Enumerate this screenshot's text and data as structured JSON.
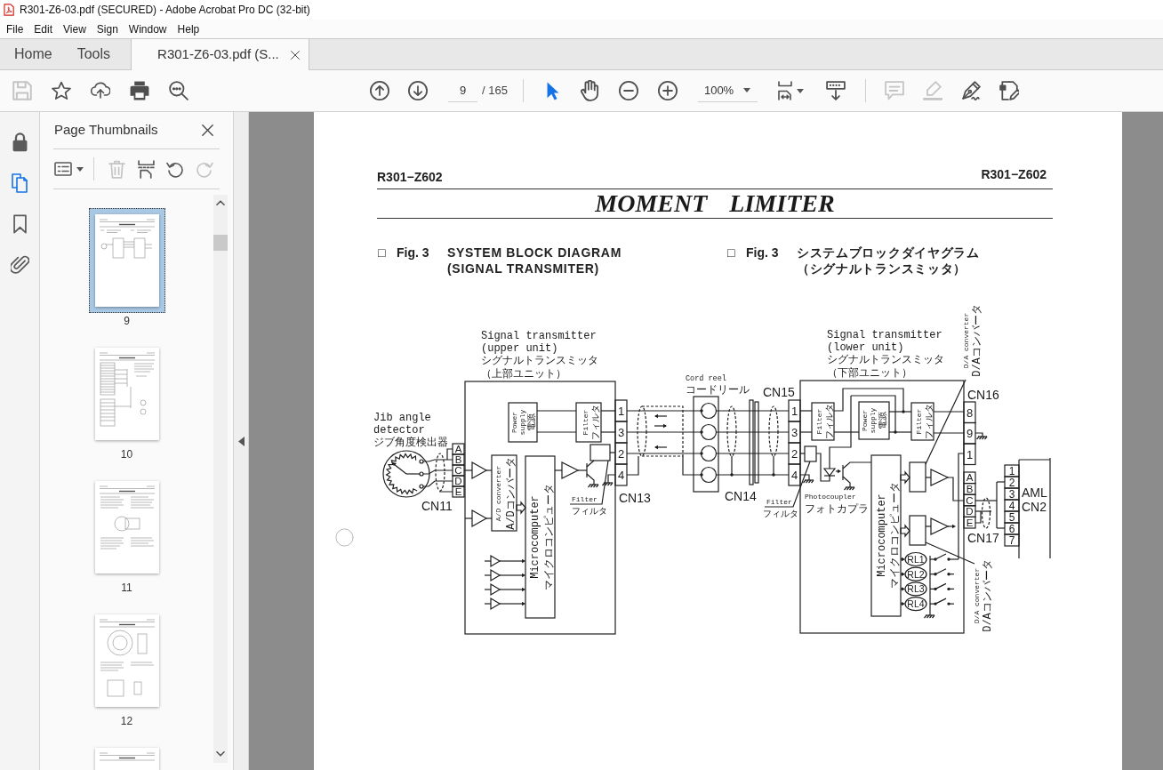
{
  "window": {
    "title": "R301-Z6-03.pdf (SECURED) - Adobe Acrobat Pro DC (32-bit)"
  },
  "menu": [
    "File",
    "Edit",
    "View",
    "Sign",
    "Window",
    "Help"
  ],
  "tabs": [
    {
      "label": "Home",
      "selected": false,
      "closable": false
    },
    {
      "label": "Tools",
      "selected": false,
      "closable": false
    },
    {
      "label": "R301-Z6-03.pdf (S...",
      "selected": true,
      "closable": true
    }
  ],
  "toolbar": {
    "file_tools": [
      {
        "kind": "save",
        "disabled": true
      },
      {
        "kind": "star",
        "disabled": false
      },
      {
        "kind": "upload",
        "disabled": false
      },
      {
        "kind": "print",
        "disabled": false
      },
      {
        "kind": "find",
        "disabled": false
      }
    ],
    "navigation": [
      {
        "kind": "previous"
      },
      {
        "kind": "next"
      }
    ],
    "page_number": "9",
    "page_count": "/ 165",
    "pointer_tools": [
      {
        "kind": "select",
        "selected": true
      },
      {
        "kind": "hand",
        "selected": false
      }
    ],
    "zoom_tools": [
      {
        "kind": "zoom-out"
      },
      {
        "kind": "zoom-in"
      }
    ],
    "zoom_level": "100%",
    "view_tools": [
      {
        "kind": "fit-page",
        "has_menu": true
      },
      {
        "kind": "scroll-mode",
        "has_menu": false
      }
    ],
    "edit_tools": [
      {
        "kind": "comment",
        "disabled": true
      },
      {
        "kind": "highlight",
        "disabled": true
      },
      {
        "kind": "sign",
        "disabled": false
      },
      {
        "kind": "edit",
        "disabled": false
      }
    ]
  },
  "left_rail": [
    {
      "kind": "lock",
      "selected": false
    },
    {
      "kind": "pages",
      "selected": true
    },
    {
      "kind": "bookmark",
      "selected": false
    },
    {
      "kind": "attachment",
      "selected": false
    }
  ],
  "thumbnails_panel": {
    "title": "Page Thumbnails",
    "tools": [
      {
        "kind": "options",
        "disabled": false
      },
      {
        "kind": "delete",
        "disabled": true
      },
      {
        "kind": "insert",
        "disabled": false
      },
      {
        "kind": "rotate-left",
        "disabled": false
      },
      {
        "kind": "rotate-right",
        "disabled": true
      }
    ],
    "pages": [
      {
        "label": "9",
        "selected": true
      },
      {
        "label": "10",
        "selected": false
      },
      {
        "label": "11",
        "selected": false
      },
      {
        "label": "12",
        "selected": false
      },
      {
        "selected": false
      }
    ]
  },
  "document": {
    "header_left": "R301−Z602",
    "header_right": "R301−Z602",
    "title": "MOMENT LIMITER",
    "captions": [
      {
        "marker": "□",
        "figure": "Fig. 3",
        "lines": [
          "SYSTEM BLOCK DIAGRAM",
          "(SIGNAL TRANSMITER)"
        ]
      },
      {
        "marker": "□",
        "figure": "Fig. 3",
        "lines": [
          "システムブロックダイヤグラム",
          "（シグナルトランスミッタ）"
        ]
      }
    ],
    "diagram": {
      "upper_unit": {
        "title": [
          "Signal transmitter",
          "(upper unit)",
          "シグナルトランスミッタ",
          "（上部ユニット）"
        ],
        "power_supply": [
          "Power",
          "supply",
          "電源"
        ],
        "filter": [
          "Filter",
          "フィルタ"
        ],
        "ad_converter": [
          "A/D converter",
          "A/Dコンバータ"
        ],
        "microcomputer": [
          "Microcomputer",
          "マイクロコンピュータ"
        ],
        "output_filter": [
          "Filter",
          "フィルタ"
        ],
        "connector": {
          "name": "CN13",
          "pins": [
            "1",
            "3",
            "2",
            "4"
          ]
        }
      },
      "jib_angle_detector": {
        "label": [
          "Jib angle",
          "detector",
          "ジブ角度検出器"
        ],
        "connector": {
          "name": "CN11",
          "pins": [
            "A",
            "B",
            "C",
            "D",
            "E"
          ]
        }
      },
      "cord_reel": {
        "label": [
          "Cord reel",
          "コードリール"
        ],
        "connector": "CN14"
      },
      "lower_unit": {
        "title": [
          "Signal transmitter",
          "(lower unit)",
          "シグナルトランスミッタ",
          "（下部ユニット）"
        ],
        "input_connector": {
          "name": "CN15",
          "pins": [
            "1",
            "3",
            "2",
            "4"
          ]
        },
        "input_filter": [
          "Filter",
          "フィルタ"
        ],
        "power_supply": [
          "Power",
          "supply",
          "電源"
        ],
        "output_filter": [
          "Filter",
          "フィルタ"
        ],
        "power_connector": {
          "name": "CN16",
          "pins": [
            "8",
            "9",
            "1"
          ]
        },
        "line_filter": [
          "Filter",
          "フィルタ"
        ],
        "photocoupler": [
          "Photocoupler",
          "フォトカプラ"
        ],
        "microcomputer": [
          "Microcomputer",
          "マイクロコンピュータ"
        ],
        "da_converters": [
          [
            "D/A converter",
            "D/Aコンバータ"
          ],
          [
            "D/A converter",
            "D/Aコンバータ"
          ]
        ],
        "relays": [
          "RL1",
          "RL2",
          "RL3",
          "RL4"
        ],
        "output_connector": {
          "name": "CN17",
          "pins": [
            "A",
            "B",
            "C",
            "D",
            "E"
          ]
        }
      },
      "aml": {
        "name": [
          "AML",
          "CN2"
        ],
        "pins": [
          "1",
          "2",
          "3",
          "4",
          "5",
          "6",
          "7"
        ]
      }
    }
  }
}
